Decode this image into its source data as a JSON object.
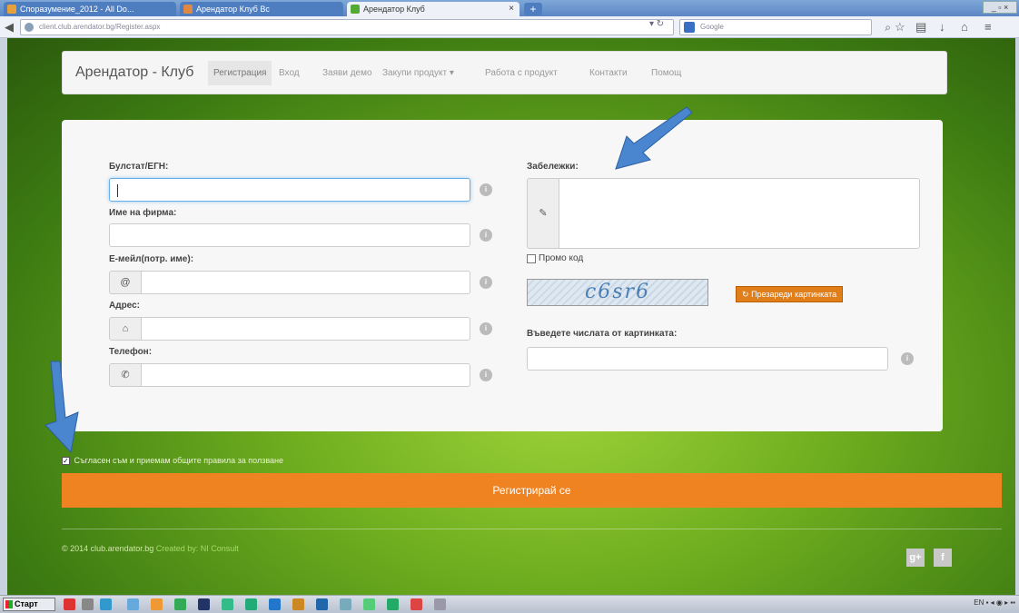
{
  "browser": {
    "tabs": [
      {
        "label": "Споразумение_2012 - All Do...",
        "icon": "folder-icon",
        "color": "#e8a13a"
      },
      {
        "label": "Арендатор Клуб Bc",
        "icon": "page-icon",
        "color": "#d84"
      },
      {
        "label": "Арендатор Клуб",
        "icon": "leaf-icon",
        "color": "#5a3"
      }
    ],
    "url": "client.club.arendator.bg/Register.aspx",
    "search_placeholder": "Google",
    "taskbar_start": "Старт",
    "tray_lang": "EN"
  },
  "site": {
    "brand": "Арендатор - Клуб",
    "nav": [
      {
        "label": "Регистрация",
        "active": true
      },
      {
        "label": "Вход"
      },
      {
        "label": "Заяви демо"
      },
      {
        "label": "Закупи продукт ▾"
      },
      {
        "label": "Работа с продукт"
      },
      {
        "label": "Контакти"
      },
      {
        "label": "Помощ"
      }
    ]
  },
  "form": {
    "bulstat_label": "Булстат/ЕГН:",
    "company_label": "Име на фирма:",
    "email_label": "E-мейл(потр. име):",
    "address_label": "Адрес:",
    "phone_label": "Телефон:",
    "notes_label": "Забележки:",
    "promo_label": "Промо код",
    "captcha_text": "c6sr6",
    "refresh_label": "Презареди картинката",
    "captcha_prompt": "Въведете числата от картинката:",
    "agree_label": "Съгласен съм и приемам общите правила за ползване",
    "submit_label": "Регистрирай се"
  },
  "footer": {
    "copyright": "© 2014 club.arendator.bg",
    "credit": "Created by: NI Consult"
  }
}
